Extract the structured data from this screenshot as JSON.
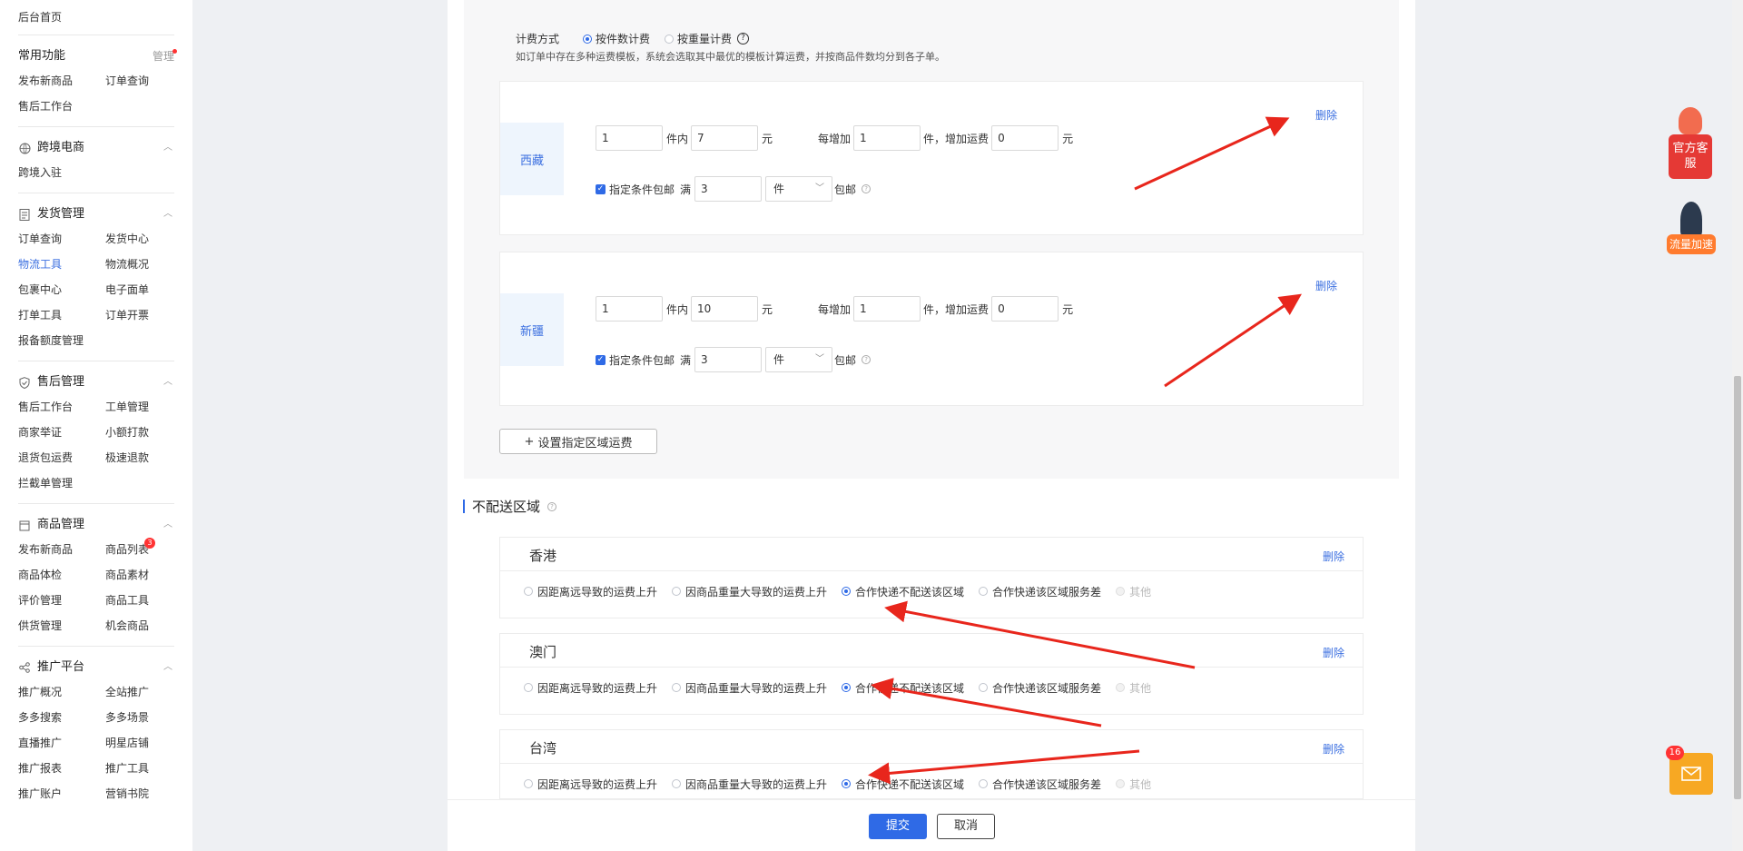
{
  "sidebar": {
    "home": "后台首页",
    "common": {
      "title": "常用功能",
      "manage": "管理",
      "items": [
        "发布新商品",
        "订单查询",
        "售后工作台"
      ]
    },
    "sections": [
      {
        "title": "跨境电商",
        "icon": "globe-icon",
        "items": [
          "跨境入驻"
        ]
      },
      {
        "title": "发货管理",
        "icon": "document-icon",
        "items": [
          "订单查询",
          "发货中心",
          "物流工具",
          "物流概况",
          "包裹中心",
          "电子面单",
          "打单工具",
          "订单开票",
          "报备额度管理"
        ],
        "active": "物流工具"
      },
      {
        "title": "售后管理",
        "icon": "shield-icon",
        "items": [
          "售后工作台",
          "工单管理",
          "商家举证",
          "小额打款",
          "退货包运费",
          "极速退款",
          "拦截单管理"
        ]
      },
      {
        "title": "商品管理",
        "icon": "bag-icon",
        "items": [
          "发布新商品",
          "商品列表",
          "商品体检",
          "商品素材",
          "评价管理",
          "商品工具",
          "供货管理",
          "机会商品"
        ],
        "badge": "3"
      },
      {
        "title": "推广平台",
        "icon": "share-icon",
        "items": [
          "推广概况",
          "全站推广",
          "多多搜索",
          "多多场景",
          "直播推广",
          "明星店铺",
          "推广报表",
          "推广工具",
          "推广账户",
          "营销书院"
        ]
      }
    ]
  },
  "fee": {
    "label": "计费方式",
    "options": [
      "按件数计费",
      "按重量计费"
    ],
    "selected": "按件数计费",
    "note": "如订单中存在多种运费模板，系统会选取其中最优的模板计算运费，并按商品件数均分到各子单。"
  },
  "regions": [
    {
      "name": "西藏",
      "first_qty": "1",
      "first_fee": "7",
      "add_qty": "1",
      "add_fee": "0",
      "free_qty": "3",
      "free_unit": "件"
    },
    {
      "name": "新疆",
      "first_qty": "1",
      "first_fee": "10",
      "add_qty": "1",
      "add_fee": "0",
      "free_qty": "3",
      "free_unit": "件"
    }
  ],
  "labels": {
    "unit_within": "件内",
    "yuan": "元",
    "each_add": "每增加",
    "add_fee": "件，增加运费",
    "free_cond": "指定条件包邮",
    "full": "满",
    "free_ship": "包邮",
    "delete": "删除",
    "add_region": "设置指定区域运费"
  },
  "no_delivery": {
    "title": "不配送区域",
    "reasons": [
      "因距离远导致的运费上升",
      "因商品重量大导致的运费上升",
      "合作快递不配送该区域",
      "合作快递该区域服务差",
      "其他"
    ],
    "regions": [
      {
        "name": "香港",
        "selected": 2
      },
      {
        "name": "澳门",
        "selected": 2
      },
      {
        "name": "台湾",
        "selected": 2
      }
    ]
  },
  "footer": {
    "submit": "提交",
    "cancel": "取消"
  },
  "floating": {
    "customer_service": "官方客服",
    "traffic": "流量加速",
    "mail_count": "16"
  },
  "colors": {
    "accent": "#2f6ae6",
    "arrow": "#e8261c"
  }
}
